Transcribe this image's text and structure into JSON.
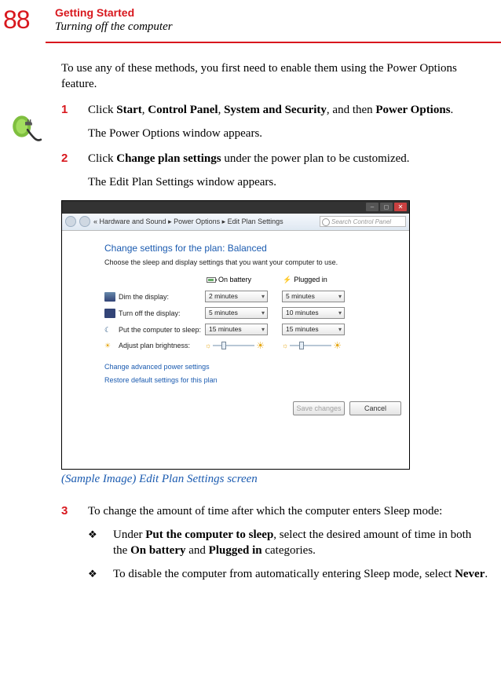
{
  "page_number": "88",
  "chapter": "Getting Started",
  "section": "Turning off the computer",
  "intro": "To use any of these methods, you first need to enable them using the Power Options feature.",
  "steps": {
    "s1": {
      "num": "1",
      "body_pre": "Click ",
      "b1": "Start",
      "c1": ", ",
      "b2": "Control Panel",
      "c2": ", ",
      "b3": "System and Security",
      "c3": ", and then ",
      "b4": "Power Options",
      "c4": ".",
      "note": "The Power Options window appears."
    },
    "s2": {
      "num": "2",
      "body_pre": "Click ",
      "b1": "Change plan settings",
      "body_post": " under the power plan to be customized.",
      "note": "The Edit Plan Settings window appears."
    },
    "s3": {
      "num": "3",
      "body": "To change the amount of time after which the computer enters Sleep mode:"
    }
  },
  "subbullets": {
    "a": {
      "pre": "Under ",
      "b1": "Put the computer to sleep",
      "mid1": ", select the desired amount of time in both the ",
      "b2": "On battery",
      "mid2": " and ",
      "b3": "Plugged in",
      "post": " categories."
    },
    "b": {
      "pre": "To disable the computer from automatically entering Sleep mode, select ",
      "b1": "Never",
      "post": "."
    }
  },
  "caption": "(Sample Image) Edit Plan Settings screen",
  "screenshot": {
    "breadcrumb": "« Hardware and Sound ▸ Power Options ▸ Edit Plan Settings",
    "search_placeholder": "Search Control Panel",
    "title": "Change settings for the plan: Balanced",
    "subtitle": "Choose the sleep and display settings that you want your computer to use.",
    "col_battery": "On battery",
    "col_plugged": "Plugged in",
    "rows": {
      "dim": {
        "label": "Dim the display:",
        "battery": "2 minutes",
        "plugged": "5 minutes"
      },
      "off": {
        "label": "Turn off the display:",
        "battery": "5 minutes",
        "plugged": "10 minutes"
      },
      "sleep": {
        "label": "Put the computer to sleep:",
        "battery": "15 minutes",
        "plugged": "15 minutes"
      },
      "bright": {
        "label": "Adjust plan brightness:"
      }
    },
    "link_adv": "Change advanced power settings",
    "link_restore": "Restore default settings for this plan",
    "btn_save": "Save changes",
    "btn_cancel": "Cancel"
  }
}
